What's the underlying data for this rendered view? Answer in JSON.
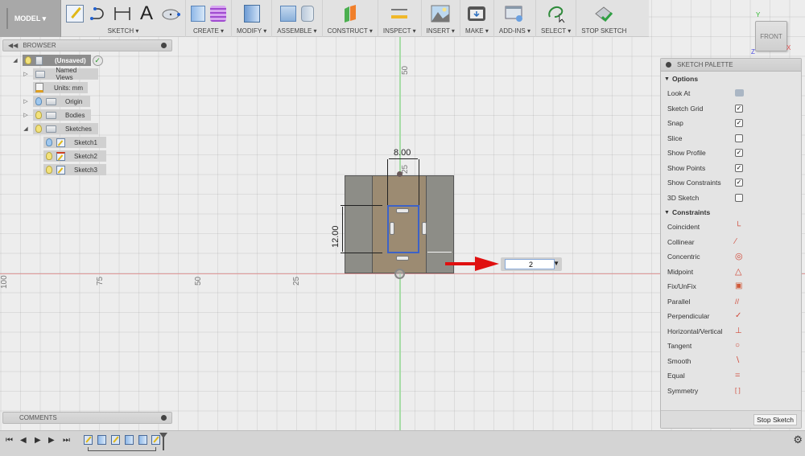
{
  "toolbar": {
    "model": "MODEL ▾",
    "groups": [
      {
        "label": "SKETCH ▾"
      },
      {
        "label": "CREATE ▾"
      },
      {
        "label": "MODIFY ▾"
      },
      {
        "label": "ASSEMBLE ▾"
      },
      {
        "label": "CONSTRUCT ▾"
      },
      {
        "label": "INSPECT ▾"
      },
      {
        "label": "INSERT ▾"
      },
      {
        "label": "MAKE ▾"
      },
      {
        "label": "ADD-INS ▾"
      },
      {
        "label": "SELECT ▾"
      },
      {
        "label": "STOP SKETCH"
      }
    ],
    "text_tool_glyph": "A"
  },
  "viewcube": {
    "face": "FRONT",
    "x_label": "X",
    "y_label": "Y",
    "z_label": "Z"
  },
  "browser": {
    "title": "BROWSER",
    "root": "(Unsaved)",
    "items": [
      {
        "label": "Named Views"
      },
      {
        "label": "Units: mm"
      },
      {
        "label": "Origin"
      },
      {
        "label": "Bodies"
      },
      {
        "label": "Sketches"
      },
      {
        "label": "Sketch1"
      },
      {
        "label": "Sketch2"
      },
      {
        "label": "Sketch3"
      }
    ]
  },
  "comments": {
    "title": "COMMENTS"
  },
  "canvas": {
    "ruler_x": [
      "100",
      "75",
      "50",
      "25"
    ],
    "ruler_y": [
      "50",
      "25"
    ],
    "dimension_width": "8.00",
    "dimension_height": "12.00",
    "dimension_input_value": "2"
  },
  "palette": {
    "title": "SKETCH PALETTE",
    "options_header": "Options",
    "options": [
      {
        "label": "Look At",
        "type": "button"
      },
      {
        "label": "Sketch Grid",
        "checked": true
      },
      {
        "label": "Snap",
        "checked": true
      },
      {
        "label": "Slice",
        "checked": false
      },
      {
        "label": "Show Profile",
        "checked": true
      },
      {
        "label": "Show Points",
        "checked": true
      },
      {
        "label": "Show Constraints",
        "checked": true
      },
      {
        "label": "3D Sketch",
        "checked": false
      }
    ],
    "constraints_header": "Constraints",
    "constraints": [
      {
        "label": "Coincident",
        "glyph": "└"
      },
      {
        "label": "Collinear",
        "glyph": "⁄"
      },
      {
        "label": "Concentric",
        "glyph": "◎"
      },
      {
        "label": "Midpoint",
        "glyph": "△"
      },
      {
        "label": "Fix/UnFix",
        "glyph": "▣"
      },
      {
        "label": "Parallel",
        "glyph": "//"
      },
      {
        "label": "Perpendicular",
        "glyph": "✓"
      },
      {
        "label": "Horizontal/Vertical",
        "glyph": "⊥"
      },
      {
        "label": "Tangent",
        "glyph": "○"
      },
      {
        "label": "Smooth",
        "glyph": "∖"
      },
      {
        "label": "Equal",
        "glyph": "="
      },
      {
        "label": "Symmetry",
        "glyph": "[ ]"
      }
    ],
    "stop_sketch": "Stop Sketch"
  },
  "colors": {
    "x_axis": "#e39b9b",
    "y_axis": "#a6dca6",
    "selection": "#3d62c6",
    "arrow": "#e01010"
  }
}
